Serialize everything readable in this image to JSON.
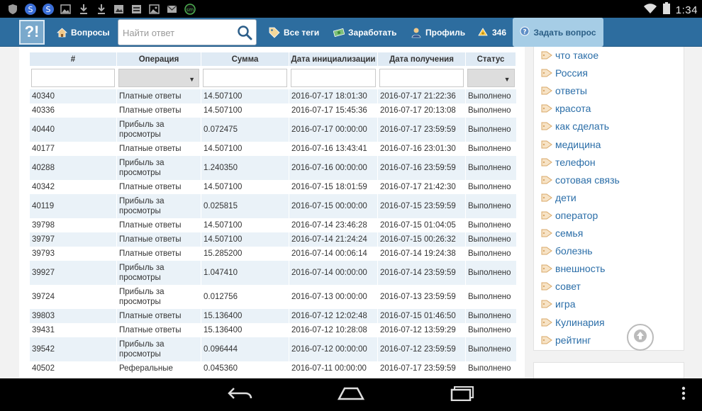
{
  "status_bar": {
    "time": "1:34"
  },
  "header": {
    "logo_text": "?!",
    "nav": {
      "questions": "Вопросы",
      "all_tags": "Все теги",
      "earn": "Заработать",
      "profile": "Профиль",
      "points": "346"
    },
    "search_placeholder": "Найти ответ",
    "ask_button": "Задать вопрос"
  },
  "table": {
    "columns": [
      "#",
      "Операция",
      "Сумма",
      "Дата инициализации",
      "Дата получения",
      "Статус"
    ],
    "rows": [
      {
        "id": "40340",
        "op": "Платные ответы",
        "sum": "14.507100",
        "init": "2016-07-17 18:01:30",
        "recv": "2016-07-17 21:22:36",
        "status": "Выполнено"
      },
      {
        "id": "40336",
        "op": "Платные ответы",
        "sum": "14.507100",
        "init": "2016-07-17 15:45:36",
        "recv": "2016-07-17 20:13:08",
        "status": "Выполнено"
      },
      {
        "id": "40440",
        "op": "Прибыль за просмотры",
        "sum": "0.072475",
        "init": "2016-07-17 00:00:00",
        "recv": "2016-07-17 23:59:59",
        "status": "Выполнено"
      },
      {
        "id": "40177",
        "op": "Платные ответы",
        "sum": "14.507100",
        "init": "2016-07-16 13:43:41",
        "recv": "2016-07-16 23:01:30",
        "status": "Выполнено"
      },
      {
        "id": "40288",
        "op": "Прибыль за просмотры",
        "sum": "1.240350",
        "init": "2016-07-16 00:00:00",
        "recv": "2016-07-16 23:59:59",
        "status": "Выполнено"
      },
      {
        "id": "40342",
        "op": "Платные ответы",
        "sum": "14.507100",
        "init": "2016-07-15 18:01:59",
        "recv": "2016-07-17 21:42:30",
        "status": "Выполнено"
      },
      {
        "id": "40119",
        "op": "Прибыль за просмотры",
        "sum": "0.025815",
        "init": "2016-07-15 00:00:00",
        "recv": "2016-07-15 23:59:59",
        "status": "Выполнено"
      },
      {
        "id": "39798",
        "op": "Платные ответы",
        "sum": "14.507100",
        "init": "2016-07-14 23:46:28",
        "recv": "2016-07-15 01:04:05",
        "status": "Выполнено"
      },
      {
        "id": "39797",
        "op": "Платные ответы",
        "sum": "14.507100",
        "init": "2016-07-14 21:24:24",
        "recv": "2016-07-15 00:26:32",
        "status": "Выполнено"
      },
      {
        "id": "39793",
        "op": "Платные ответы",
        "sum": "15.285200",
        "init": "2016-07-14 00:06:14",
        "recv": "2016-07-14 19:24:38",
        "status": "Выполнено"
      },
      {
        "id": "39927",
        "op": "Прибыль за просмотры",
        "sum": "1.047410",
        "init": "2016-07-14 00:00:00",
        "recv": "2016-07-14 23:59:59",
        "status": "Выполнено"
      },
      {
        "id": "39724",
        "op": "Прибыль за просмотры",
        "sum": "0.012756",
        "init": "2016-07-13 00:00:00",
        "recv": "2016-07-13 23:59:59",
        "status": "Выполнено"
      },
      {
        "id": "39803",
        "op": "Платные ответы",
        "sum": "15.136400",
        "init": "2016-07-12 12:02:48",
        "recv": "2016-07-15 01:46:50",
        "status": "Выполнено"
      },
      {
        "id": "39431",
        "op": "Платные ответы",
        "sum": "15.136400",
        "init": "2016-07-12 10:28:08",
        "recv": "2016-07-12 13:59:29",
        "status": "Выполнено"
      },
      {
        "id": "39542",
        "op": "Прибыль за просмотры",
        "sum": "0.096444",
        "init": "2016-07-12 00:00:00",
        "recv": "2016-07-12 23:59:59",
        "status": "Выполнено"
      },
      {
        "id": "40502",
        "op": "Реферальные",
        "sum": "0.045360",
        "init": "2016-07-11 00:00:00",
        "recv": "2016-07-17 23:59:59",
        "status": "Выполнено"
      }
    ]
  },
  "sidebar": {
    "tags": [
      "что такое",
      "Россия",
      "ответы",
      "красота",
      "как сделать",
      "медицина",
      "телефон",
      "сотовая связь",
      "дети",
      "оператор",
      "семья",
      "болезнь",
      "внешность",
      "совет",
      "игра",
      "Кулинария",
      "рейтинг"
    ]
  }
}
